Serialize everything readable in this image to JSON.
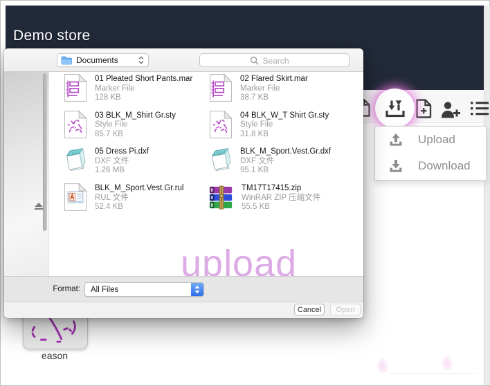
{
  "header": {
    "title": "Demo store"
  },
  "toolbar": {
    "buttons": [
      {
        "icon": "copy-document-icon"
      },
      {
        "icon": "file-transfer-icon",
        "highlighted": true
      },
      {
        "icon": "add-file-icon"
      },
      {
        "icon": "add-user-icon"
      },
      {
        "icon": "list-view-icon"
      }
    ]
  },
  "transfer_menu": {
    "items": [
      {
        "label": "Upload",
        "icon": "upload-icon"
      },
      {
        "label": "Download",
        "icon": "download-icon"
      }
    ]
  },
  "file_dialog": {
    "location": "Documents",
    "search_placeholder": "Search",
    "files": [
      {
        "name": "01 Pleated Short Pants.mar",
        "type": "Marker File",
        "size": "128 KB",
        "icon": "marker-file"
      },
      {
        "name": "02 Flared Skirt.mar",
        "type": "Marker File",
        "size": "38.7 KB",
        "icon": "marker-file"
      },
      {
        "name": "03 BLK_M_Shirt Gr.sty",
        "type": "Style File",
        "size": "85.7 KB",
        "icon": "style-file"
      },
      {
        "name": "04 BLK_W_T Shirt Gr.sty",
        "type": "Style File",
        "size": "31.8 KB",
        "icon": "style-file"
      },
      {
        "name": "05 Dress Pi.dxf",
        "type": "DXF 文件",
        "size": "1.26 MB",
        "icon": "dxf-file"
      },
      {
        "name": "BLK_M_Sport.Vest.Gr.dxf",
        "type": "DXF 文件",
        "size": "95.1 KB",
        "icon": "dxf-file"
      },
      {
        "name": "BLK_M_Sport.Vest.Gr.rul",
        "type": "RUL 文件",
        "size": "52.4 KB",
        "icon": "rul-file"
      },
      {
        "name": "TM17T17415.zip",
        "type": "WinRAR ZIP 压缩文件",
        "size": "55.5 KB",
        "icon": "zip-file"
      }
    ],
    "watermark": "upload",
    "format": {
      "label": "Format:",
      "value": "All Files"
    },
    "buttons": {
      "cancel": "Cancel",
      "open": "Open"
    }
  },
  "desktop": {
    "file_label": "eason"
  },
  "colors": {
    "header_bg": "#222938",
    "highlight_glow": "#e276d8",
    "watermark_pink": "#dcaae4",
    "marker_purple": "#b44cc4"
  }
}
